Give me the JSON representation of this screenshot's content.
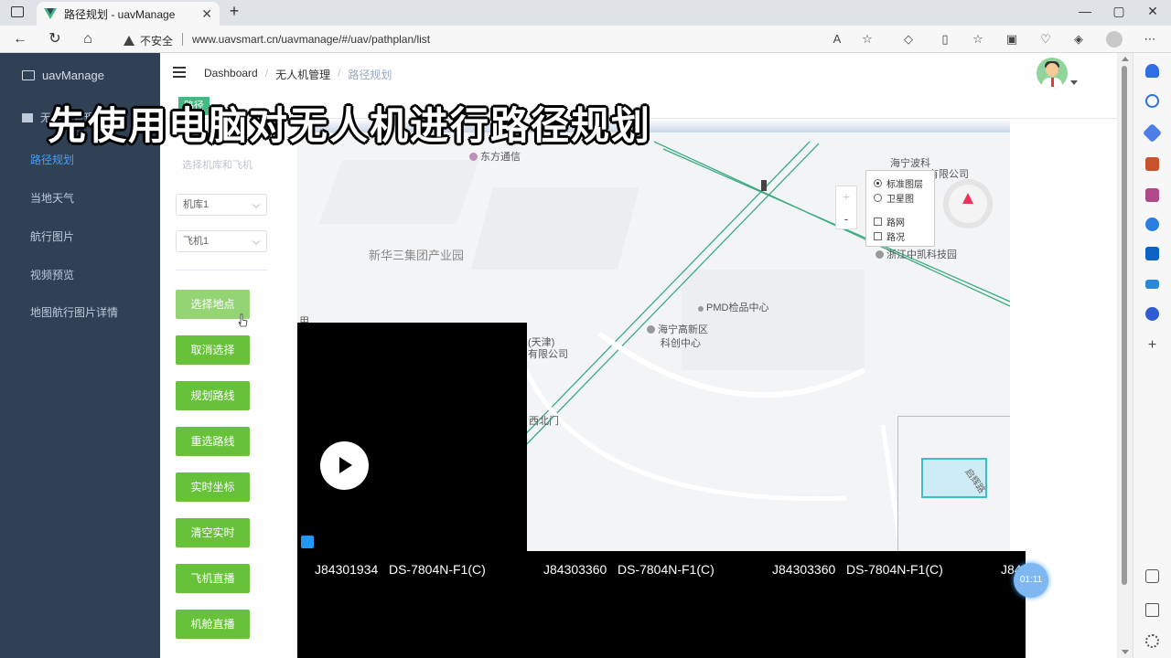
{
  "browser": {
    "tab_title": "路径规划 - uavManage",
    "tab_close": "✕",
    "new_tab": "+",
    "security_label": "不安全",
    "url": "www.uavsmart.cn/uavmanage/#/uav/pathplan/list",
    "window_controls": [
      "—",
      "▢",
      "✕"
    ]
  },
  "sidebar": {
    "brand": "uavManage",
    "group_label": "无人机管理",
    "items": [
      {
        "label": "路径规划",
        "active": true
      },
      {
        "label": "当地天气"
      },
      {
        "label": "航行图片"
      },
      {
        "label": "视频预览"
      },
      {
        "label": "地图航行图片详情"
      }
    ]
  },
  "header": {
    "breadcrumb": [
      "Dashboard",
      "无人机管理",
      "路径规划"
    ],
    "breadcrumb_sep": "/",
    "tag": "路径"
  },
  "overlay_title": "先使用电脑对无人机进行路径规划",
  "panel": {
    "select_placeholder": "选择机库和飞机",
    "hangar_value": "机库1",
    "plane_value": "飞机1",
    "buttons": [
      "选择地点",
      "取消选择",
      "规划路线",
      "重选路线",
      "实时坐标",
      "清空实时",
      "飞机直播",
      "机舱直播"
    ]
  },
  "map": {
    "pois": {
      "dongfang": "东方通信",
      "haining_bo": "海宁波科",
      "youxian": "有限公司",
      "xinhua": "新华三集团产业园",
      "pmd": "PMD检品中心",
      "gaoxin1": "海宁高新区",
      "gaoxin2": "科创中心",
      "tianjin": "(天津)",
      "tianjin2": "有限公司",
      "xibeimen": "西北门",
      "zhongkai": "浙江中凯科技园",
      "edge": "用"
    },
    "layers": {
      "standard": "标准图层",
      "satellite": "卫星图",
      "roadnet": "路网",
      "traffic": "路况"
    },
    "zoom_in": "+",
    "zoom_out": "-",
    "minimap_label": "启辉路"
  },
  "video": {
    "cams": [
      {
        "id": "J84301934",
        "model": "DS-7804N-F1(C)"
      },
      {
        "id": "J84303360",
        "model": "DS-7804N-F1(C)"
      },
      {
        "id": "J84303360",
        "model": "DS-7804N-F1(C)"
      },
      {
        "id": "J84",
        "model": ""
      }
    ],
    "timer": "01:11"
  },
  "colors": {
    "sidebar_bg": "#304156",
    "active": "#409eff",
    "button_green": "#67c23a",
    "road_green": "#3cab83"
  }
}
